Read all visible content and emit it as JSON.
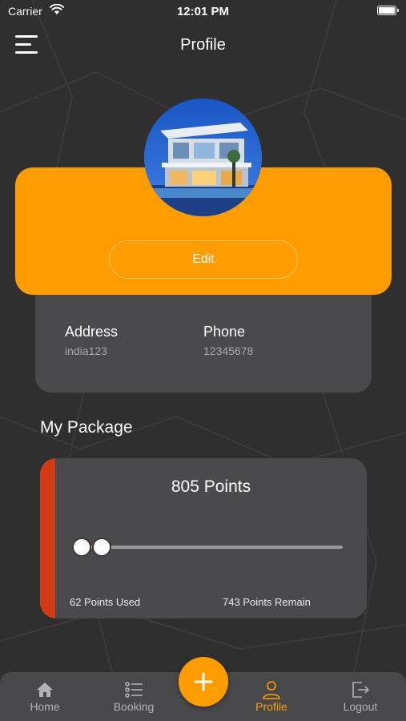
{
  "status_bar": {
    "carrier": "Carrier",
    "time": "12:01 PM"
  },
  "header": {
    "title": "Profile",
    "menu_icon": "hamburger-menu-icon"
  },
  "profile": {
    "edit_label": "Edit",
    "address_label": "Address",
    "address_value": "india123",
    "phone_label": "Phone",
    "phone_value": "12345678"
  },
  "package": {
    "section_title": "My Package",
    "points_total": "805 Points",
    "points_used": "62 Points Used",
    "points_remain": "743 Points Remain",
    "used_value": 62,
    "total_value": 805
  },
  "tab_bar": {
    "items": [
      {
        "label": "Home",
        "icon": "home-icon",
        "active": false
      },
      {
        "label": "Booking",
        "icon": "list-icon",
        "active": false
      },
      {
        "label": "Profile",
        "icon": "user-icon",
        "active": true
      },
      {
        "label": "Logout",
        "icon": "logout-icon",
        "active": false
      }
    ],
    "fab_icon": "plus-icon"
  },
  "colors": {
    "accent": "#ff9d00",
    "background": "#2f2f30",
    "card": "#4a4a4c",
    "package_accent": "#d23a16"
  }
}
